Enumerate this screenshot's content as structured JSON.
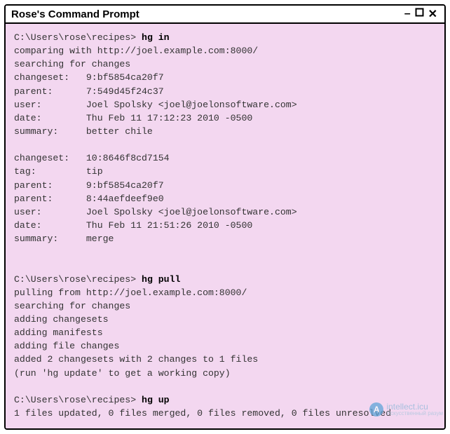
{
  "window": {
    "title": "Rose's Command Prompt",
    "controls": {
      "minimize": "–",
      "maximize_icon": "maximize-icon",
      "close": "✕"
    }
  },
  "prompt1": {
    "path": "C:\\Users\\rose\\recipes>",
    "command": "hg in"
  },
  "output1": [
    "comparing with http://joel.example.com:8000/",
    "searching for changes",
    "changeset:   9:bf5854ca20f7",
    "parent:      7:549d45f24c37",
    "user:        Joel Spolsky <joel@joelonsoftware.com>",
    "date:        Thu Feb 11 17:12:23 2010 -0500",
    "summary:     better chile",
    "",
    "changeset:   10:8646f8cd7154",
    "tag:         tip",
    "parent:      9:bf5854ca20f7",
    "parent:      8:44aefdeef9e0",
    "user:        Joel Spolsky <joel@joelonsoftware.com>",
    "date:        Thu Feb 11 21:51:26 2010 -0500",
    "summary:     merge",
    "",
    ""
  ],
  "prompt2": {
    "path": "C:\\Users\\rose\\recipes>",
    "command": "hg pull"
  },
  "output2": [
    "pulling from http://joel.example.com:8000/",
    "searching for changes",
    "adding changesets",
    "adding manifests",
    "adding file changes",
    "added 2 changesets with 2 changes to 1 files",
    "(run 'hg update' to get a working copy)",
    ""
  ],
  "prompt3": {
    "path": "C:\\Users\\rose\\recipes>",
    "command": "hg up"
  },
  "output3": [
    "1 files updated, 0 files merged, 0 files removed, 0 files unresolved"
  ],
  "watermark": {
    "letter": "A",
    "text": "intellect.icu",
    "sub": "Искусственный разум"
  }
}
